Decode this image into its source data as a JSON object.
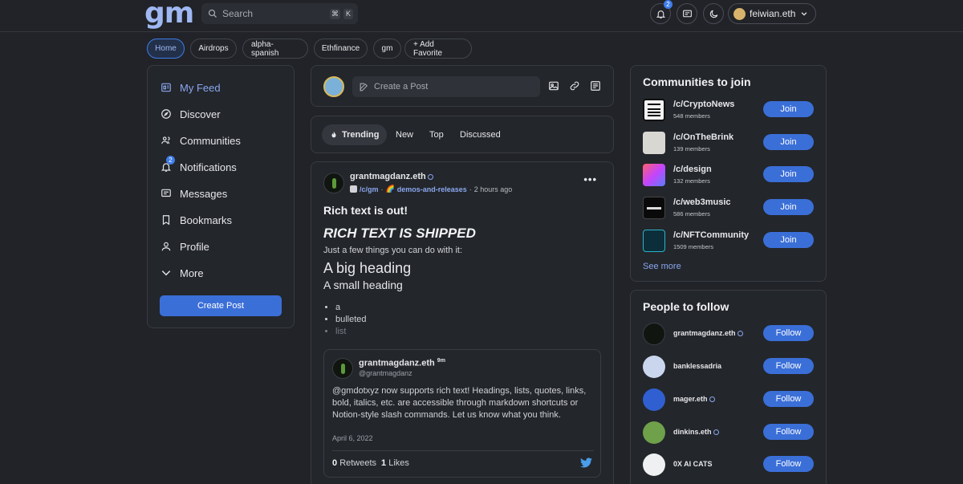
{
  "header": {
    "logo": "gm",
    "search_placeholder": "Search",
    "shortcut_keys": [
      "⌘",
      "K"
    ],
    "notifications_count": "2",
    "username": "feiwian.eth"
  },
  "favorites": {
    "items": [
      "Home",
      "Airdrops",
      "alpha-spanish",
      "Ethfinance",
      "gm"
    ],
    "add_label": "+ Add Favorite"
  },
  "sidebar": {
    "items": [
      {
        "label": "My Feed",
        "icon": "feed-icon"
      },
      {
        "label": "Discover",
        "icon": "compass-icon"
      },
      {
        "label": "Communities",
        "icon": "users-icon"
      },
      {
        "label": "Notifications",
        "icon": "bell-icon",
        "badge": "2"
      },
      {
        "label": "Messages",
        "icon": "message-icon"
      },
      {
        "label": "Bookmarks",
        "icon": "bookmark-icon"
      },
      {
        "label": "Profile",
        "icon": "user-icon"
      },
      {
        "label": "More",
        "icon": "chevron-down-icon"
      }
    ],
    "create_post": "Create Post"
  },
  "composer": {
    "placeholder": "Create a Post"
  },
  "feed_tabs": [
    "Trending",
    "New",
    "Top",
    "Discussed"
  ],
  "post": {
    "author": "grantmagdanz.eth",
    "community": "/c/gm",
    "sep1": "·",
    "channel_emoji": "🌈",
    "channel": "demos-and-releases",
    "sep2": "·",
    "time": "2 hours ago",
    "menu": "•••",
    "title": "Rich text is out!",
    "heading_italic": "RICH TEXT IS SHIPPED",
    "paragraph": "Just a few things you can do with it:",
    "big_heading": "A big heading",
    "small_heading": "A small heading",
    "bullets": [
      "a",
      "bulleted",
      "list"
    ],
    "embed": {
      "name": "grantmagdanz.eth",
      "age": "9m",
      "handle": "@grantmagdanz",
      "text": "@gmdotxyz now supports rich text! Headings, lists, quotes, links, bold, italics, etc. are accessible through markdown shortcuts or Notion-style slash commands. Let us know what you think.",
      "date": "April 6, 2022",
      "retweets_count": "0",
      "retweets_label": "Retweets",
      "likes_count": "1",
      "likes_label": "Likes"
    }
  },
  "communities": {
    "title": "Communities to join",
    "items": [
      {
        "name": "/c/CryptoNews",
        "members": "548 members",
        "cta": "Join"
      },
      {
        "name": "/c/OnTheBrink",
        "members": "139 members",
        "cta": "Join"
      },
      {
        "name": "/c/design",
        "members": "132 members",
        "cta": "Join"
      },
      {
        "name": "/c/web3music",
        "members": "586 members",
        "cta": "Join"
      },
      {
        "name": "/c/NFTCommunity",
        "members": "1509 members",
        "cta": "Join"
      }
    ],
    "see_more": "See more"
  },
  "people": {
    "title": "People to follow",
    "items": [
      {
        "name": "grantmagdanz.eth",
        "cta": "Follow"
      },
      {
        "name": "banklessadria",
        "cta": "Follow"
      },
      {
        "name": "mager.eth",
        "cta": "Follow"
      },
      {
        "name": "dinkins.eth",
        "cta": "Follow"
      },
      {
        "name": "0X AI CATS",
        "cta": "Follow"
      }
    ]
  },
  "colors": {
    "background": "#212328",
    "card": "#23262b",
    "accent": "#3b6fd8",
    "link": "#8aa7ee"
  }
}
